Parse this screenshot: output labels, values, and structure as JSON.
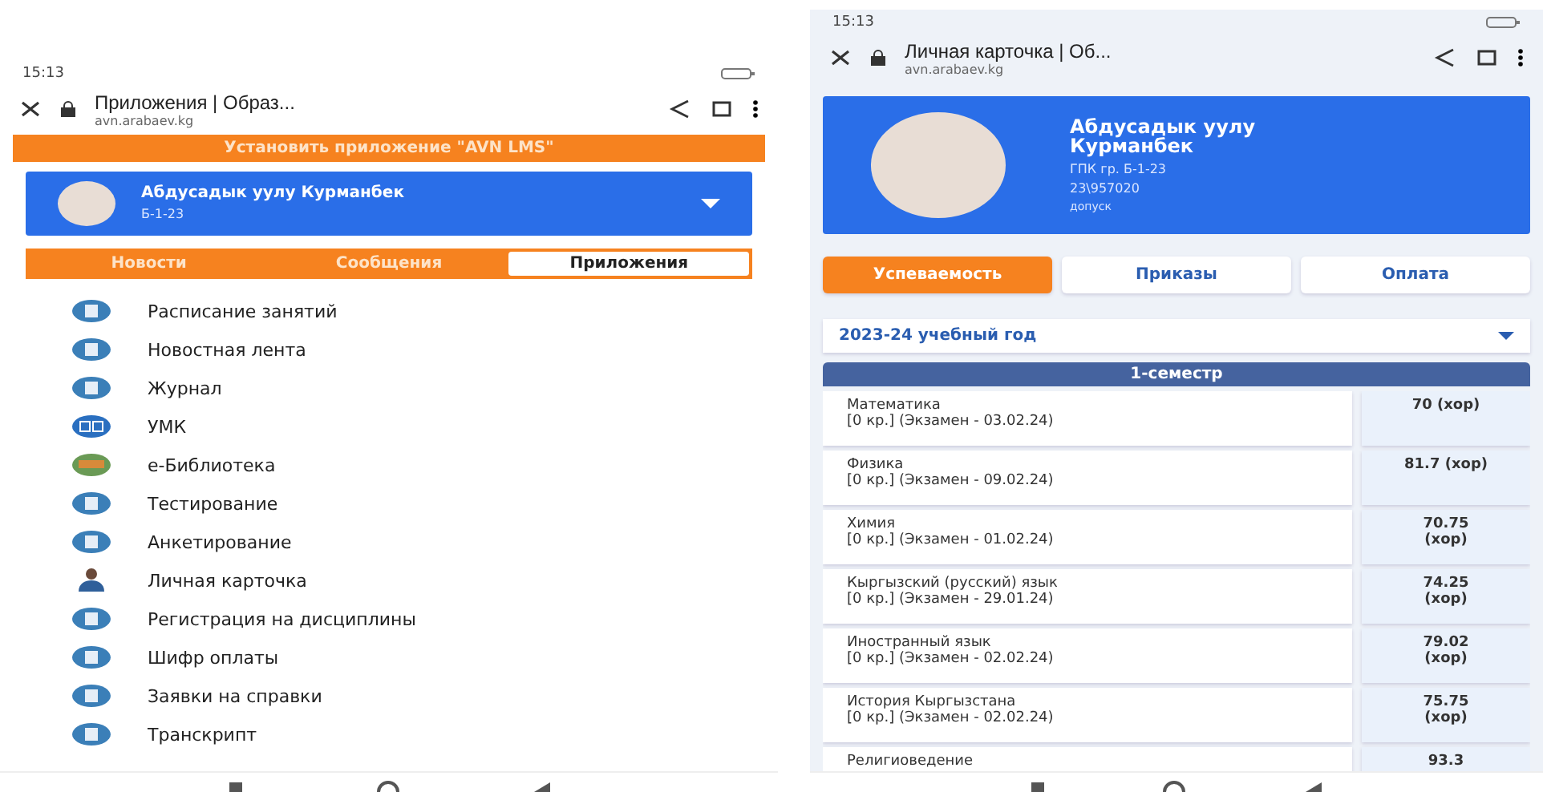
{
  "left_phone": {
    "status_bar": {
      "time": "15:13"
    },
    "browser_bar": {
      "title": "Приложения | Образ...",
      "url": "avn.arabaev.kg"
    },
    "install_banner": "Установить приложение \"AVN LMS\"",
    "profile": {
      "name": "Абдусадык уулу Курманбек",
      "group": "Б-1-23"
    },
    "tabs": [
      {
        "label": "Новости",
        "selected": false
      },
      {
        "label": "Сообщения",
        "selected": false
      },
      {
        "label": "Приложения",
        "selected": true
      }
    ],
    "apps": [
      {
        "label": "Расписание занятий",
        "kind": "doc"
      },
      {
        "label": "Новостная лента",
        "kind": "doc"
      },
      {
        "label": "Журнал",
        "kind": "doc"
      },
      {
        "label": "УМК",
        "kind": "book"
      },
      {
        "label": "е-Библиотека",
        "kind": "library"
      },
      {
        "label": "Тестирование",
        "kind": "doc"
      },
      {
        "label": "Анкетирование",
        "kind": "doc"
      },
      {
        "label": "Личная карточка",
        "kind": "person"
      },
      {
        "label": "Регистрация на дисциплины",
        "kind": "doc"
      },
      {
        "label": "Шифр оплаты",
        "kind": "doc"
      },
      {
        "label": "Заявки на справки",
        "kind": "doc"
      },
      {
        "label": "Транскрипт",
        "kind": "doc"
      }
    ]
  },
  "right_phone": {
    "status_bar": {
      "time": "15:13"
    },
    "browser_bar": {
      "title": "Личная карточка | Об...",
      "url": "avn.arabaev.kg"
    },
    "profile": {
      "name": "Абдусадык уулу Курманбек",
      "group": "ГПК гр. Б-1-23",
      "code": "23\\957020",
      "status": "допуск"
    },
    "tabs": [
      {
        "label": "Успеваемость",
        "selected": true
      },
      {
        "label": "Приказы",
        "selected": false
      },
      {
        "label": "Оплата",
        "selected": false
      }
    ],
    "year_select": "2023-24 учебный год",
    "semester": "1-семестр",
    "grades": [
      {
        "subject": "Математика",
        "detail": "[0 кр.] (Экзамен - 03.02.24)",
        "grade": "70 (хор)"
      },
      {
        "subject": "Физика",
        "detail": "[0 кр.] (Экзамен - 09.02.24)",
        "grade": "81.7 (хор)"
      },
      {
        "subject": "Химия",
        "detail": "[0 кр.] (Экзамен - 01.02.24)",
        "grade": "70.75 (хор)"
      },
      {
        "subject": "Кыргызский (русский) язык",
        "detail": "[0 кр.] (Экзамен - 29.01.24)",
        "grade": "74.25 (хор)"
      },
      {
        "subject": "Иностранный язык",
        "detail": "[0 кр.] (Экзамен - 02.02.24)",
        "grade": "79.02 (хор)"
      },
      {
        "subject": "История Кыргызстана",
        "detail": "[0 кр.] (Экзамен - 02.02.24)",
        "grade": "75.75 (хор)"
      },
      {
        "subject": "Религиоведение",
        "grade": "93.3"
      }
    ]
  }
}
